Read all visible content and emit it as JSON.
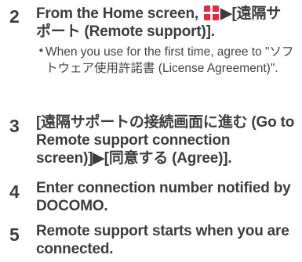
{
  "steps": [
    {
      "number": "2",
      "line1_before": "From the Home screen, ",
      "line1_after": "▶[遠隔サ",
      "line2": "ポート (Remote support)].",
      "home_icon": "apps-grid-icon",
      "note_bullet": "•",
      "note": "When you use for the first time, agree to \"ソフトウェア使用許諾書 (License Agreement)\"."
    },
    {
      "number": "3",
      "text": "[遠隔サポートの接続画面に進む (Go to Remote support connection screen)]▶[同意する (Agree)]."
    },
    {
      "number": "4",
      "text": "Enter connection number notified by DOCOMO."
    },
    {
      "number": "5",
      "text": "Remote support starts when you are connected."
    }
  ],
  "colors": {
    "accent": "#e8283c",
    "text": "#3d3d3d"
  }
}
